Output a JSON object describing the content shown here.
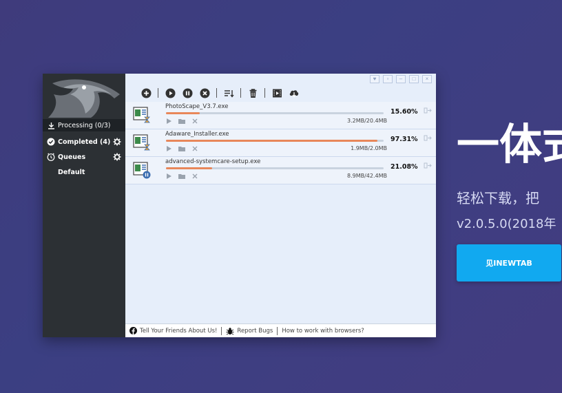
{
  "sidebar": {
    "items": [
      {
        "label": "Processing (0/3)"
      },
      {
        "label": "Completed (4)"
      },
      {
        "label": "Queues"
      },
      {
        "label": "Default"
      }
    ]
  },
  "downloads": [
    {
      "name": "PhotoScape_V3.7.exe",
      "percent": "15.60%",
      "progress": 0.156,
      "size": "3.2MB/20.4MB",
      "state": "downloading"
    },
    {
      "name": "Adaware_Installer.exe",
      "percent": "97.31%",
      "progress": 0.9731,
      "size": "1.9MB/2.0MB",
      "state": "downloading"
    },
    {
      "name": "advanced-systemcare-setup.exe",
      "percent": "21.08%",
      "progress": 0.2108,
      "size": "8.9MB/42.4MB",
      "state": "paused"
    }
  ],
  "statusbar": {
    "tell_friends": "Tell Your Friends About Us!",
    "report_bugs": "Report Bugs",
    "browsers": "How to work with browsers?"
  },
  "hero": {
    "title": "一体式",
    "subtitle": "轻松下载，把",
    "version": "v2.0.5.0(2018年",
    "button_label": "见INEWTAB"
  },
  "colors": {
    "accent": "#11a9f0",
    "progress": "#e8875a",
    "sidebar": "#2c3034"
  }
}
